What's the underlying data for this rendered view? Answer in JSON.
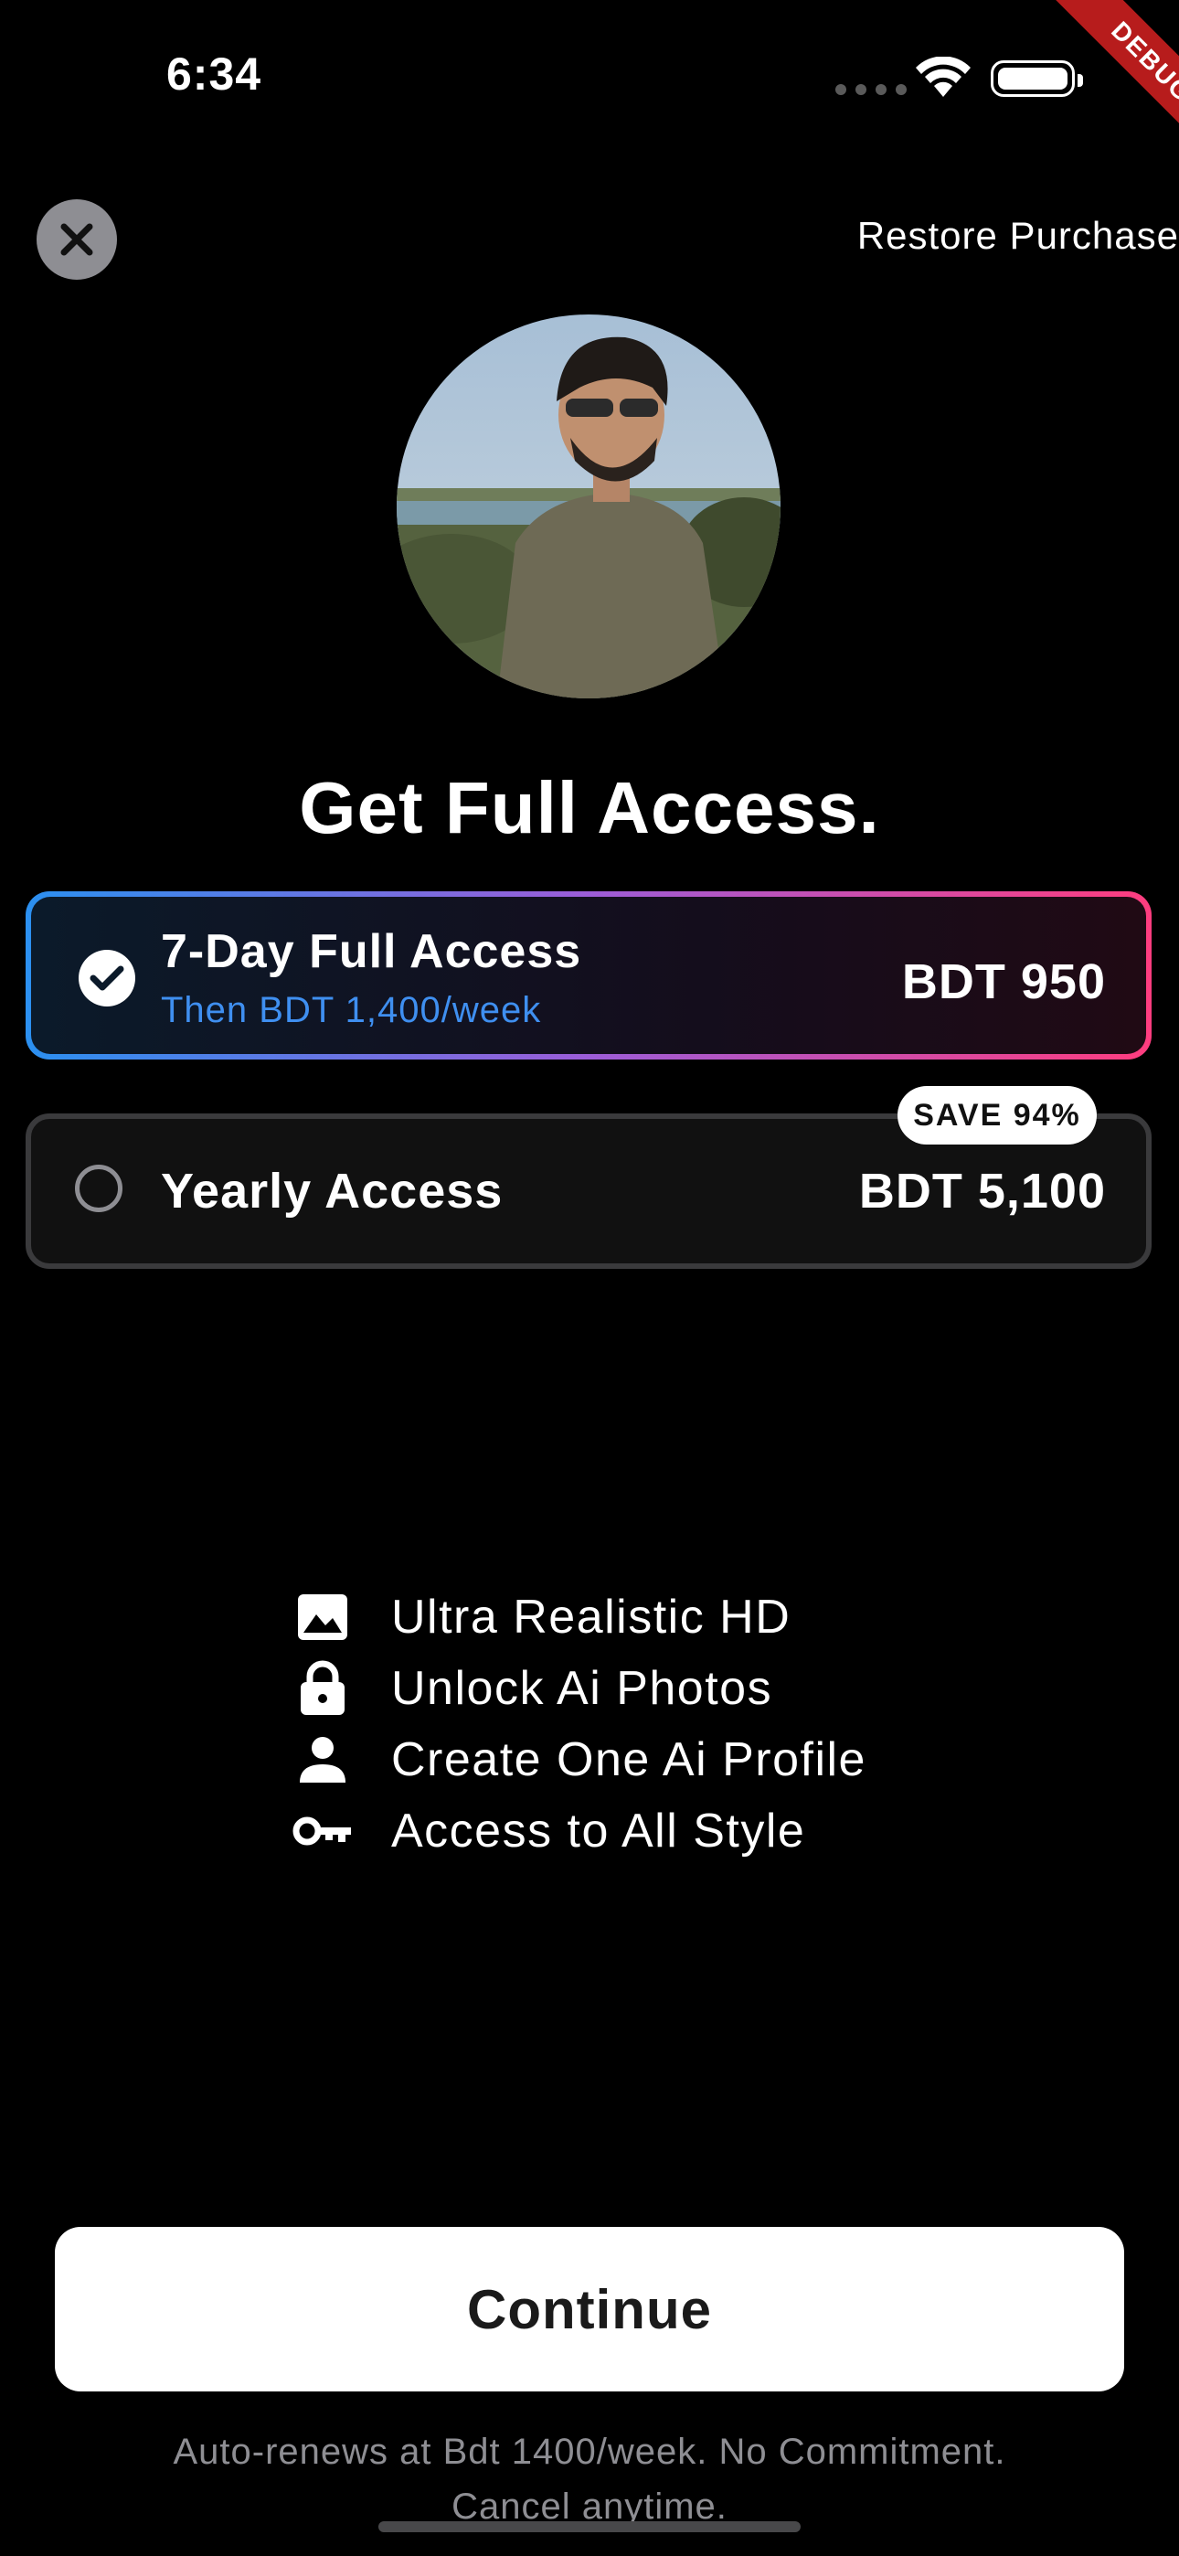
{
  "status_bar": {
    "time": "6:34",
    "debug_label": "DEBUG"
  },
  "header": {
    "restore_label": "Restore Purchase"
  },
  "title": "Get Full Access.",
  "plans": [
    {
      "name": "7-Day Full Access",
      "subtitle": "Then BDT 1,400/week",
      "price": "BDT 950",
      "selected": true
    },
    {
      "name": "Yearly Access",
      "price": "BDT 5,100",
      "badge": "SAVE 94%",
      "selected": false
    }
  ],
  "features": [
    {
      "icon": "image-icon",
      "label": "Ultra Realistic HD"
    },
    {
      "icon": "lock-icon",
      "label": "Unlock Ai Photos"
    },
    {
      "icon": "person-icon",
      "label": "Create One Ai Profile"
    },
    {
      "icon": "key-icon",
      "label": "Access to All Style"
    }
  ],
  "cta": {
    "label": "Continue"
  },
  "footer": {
    "line1": "Auto-renews at Bdt 1400/week. No Commitment.",
    "line2": "Cancel anytime."
  },
  "colors": {
    "accent_blue": "#2b90f0",
    "accent_pink": "#ff3d7f",
    "background": "#000000"
  }
}
